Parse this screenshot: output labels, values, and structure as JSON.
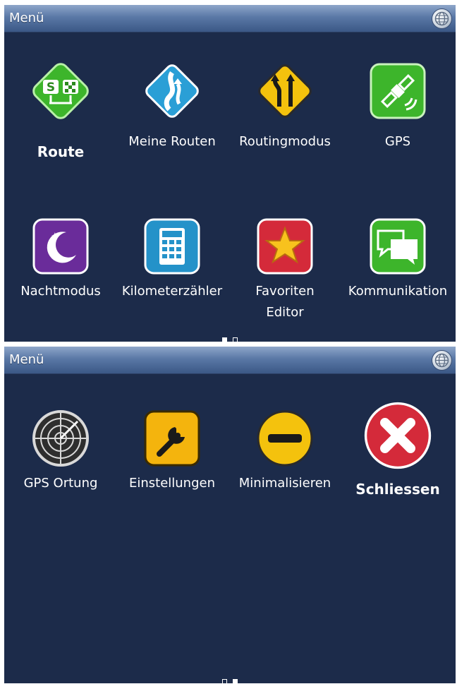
{
  "panel1": {
    "title": "Menü",
    "items": [
      {
        "label": "Route",
        "icon": "route-icon"
      },
      {
        "label": "Meine Routen",
        "icon": "my-routes-icon"
      },
      {
        "label": "Routingmodus",
        "icon": "routing-mode-icon"
      },
      {
        "label": "GPS",
        "icon": "gps-satellite-icon"
      },
      {
        "label": "Nachtmodus",
        "icon": "night-mode-moon-icon"
      },
      {
        "label": "Kilometerzähler",
        "icon": "odometer-calculator-icon"
      },
      {
        "label_line1": "Favoriten",
        "label_line2": "Editor",
        "icon": "favorites-star-icon"
      },
      {
        "label": "Kommunikation",
        "icon": "communication-chat-icon"
      }
    ],
    "page_active": 1,
    "page_count": 2
  },
  "panel2": {
    "title": "Menü",
    "items": [
      {
        "label": "GPS Ortung",
        "icon": "gps-radar-icon"
      },
      {
        "label": "Einstellungen",
        "icon": "settings-wrench-icon"
      },
      {
        "label": "Minimalisieren",
        "icon": "minimize-icon"
      },
      {
        "label": "Schliessen",
        "icon": "close-x-icon"
      }
    ],
    "page_active": 2,
    "page_count": 2
  },
  "colors": {
    "background": "#1c2b4a",
    "titlebar": "#5a78a6",
    "text": "#ffffff"
  }
}
